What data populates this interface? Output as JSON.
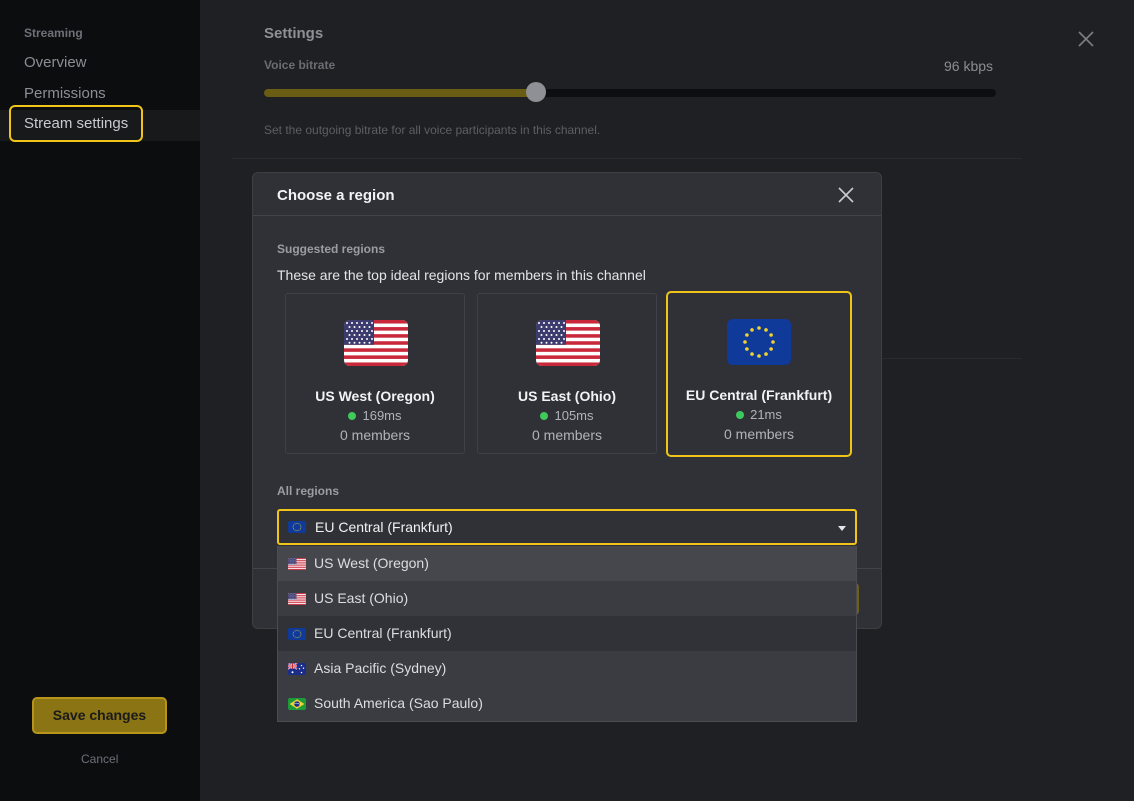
{
  "sidebar": {
    "section": "Streaming",
    "items": [
      {
        "label": "Overview"
      },
      {
        "label": "Permissions"
      },
      {
        "label": "Stream settings"
      }
    ],
    "save_label": "Save changes",
    "cancel_label": "Cancel"
  },
  "main": {
    "title": "Settings",
    "voice_bitrate": {
      "label": "Voice bitrate",
      "value": "96 kbps",
      "fraction": 0.371,
      "help": "Set the outgoing bitrate for all voice participants in this channel."
    }
  },
  "modal": {
    "title": "Choose a region",
    "suggested_label": "Suggested regions",
    "suggested_desc": "These are the top ideal regions for members in this channel",
    "cards": [
      {
        "name": "US West (Oregon)",
        "latency": "169ms",
        "members": "0 members",
        "flag": "us-flag"
      },
      {
        "name": "US East (Ohio)",
        "latency": "105ms",
        "members": "0 members",
        "flag": "us-flag"
      },
      {
        "name": "EU Central (Frankfurt)",
        "latency": "21ms",
        "members": "0 members",
        "flag": "eu-flag"
      }
    ],
    "all_label": "All regions",
    "selected_region": "EU Central (Frankfurt)",
    "options": [
      {
        "label": "US West (Oregon)",
        "flag": "us-flag"
      },
      {
        "label": "US East (Ohio)",
        "flag": "us-flag"
      },
      {
        "label": "EU Central (Frankfurt)",
        "flag": "eu-flag"
      },
      {
        "label": "Asia Pacific (Sydney)",
        "flag": "au-flag"
      },
      {
        "label": "South America (Sao Paulo)",
        "flag": "br-flag"
      }
    ]
  },
  "colors": {
    "accent": "#f0c419",
    "online": "#3ec95c"
  }
}
